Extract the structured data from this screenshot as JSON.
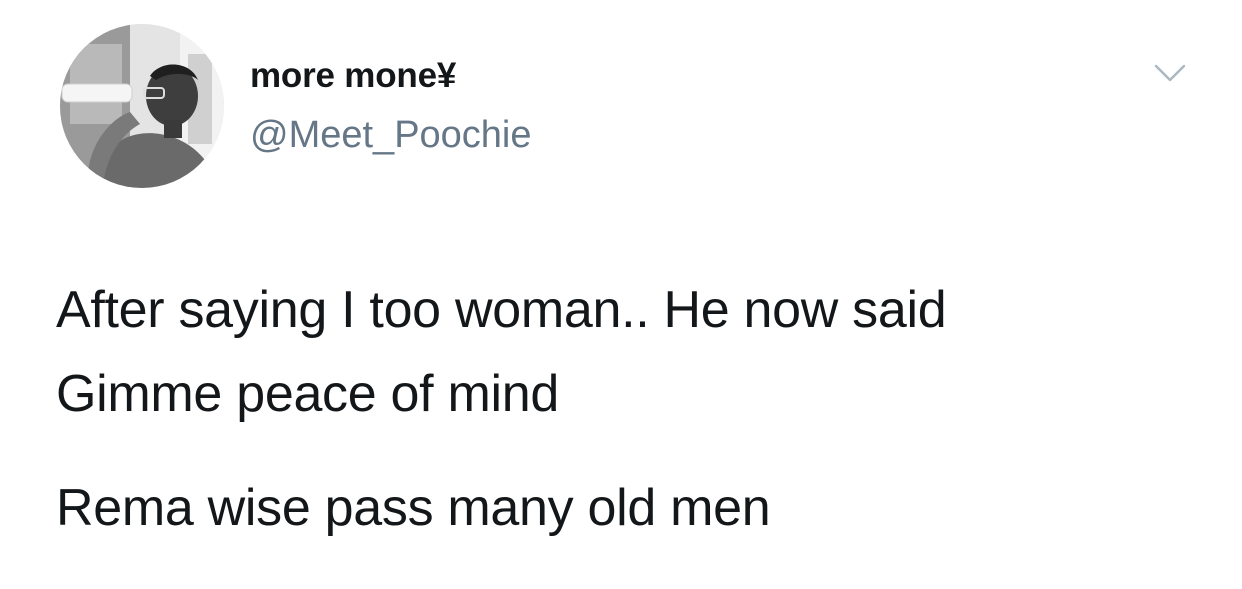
{
  "tweet": {
    "author": {
      "display_name": "more mone¥",
      "handle": "@Meet_Poochie",
      "avatar_icon": "profile-photo"
    },
    "menu_icon": "chevron-down-icon",
    "text": {
      "paragraph_1": {
        "line_1": "After saying I too woman.. He now said",
        "line_2": "Gimme peace of mind"
      },
      "paragraph_2": {
        "line_1": "Rema wise pass many old men"
      }
    }
  },
  "colors": {
    "name": "#14171a",
    "handle": "#657786",
    "chevron": "#aab8c2",
    "background": "#ffffff"
  }
}
